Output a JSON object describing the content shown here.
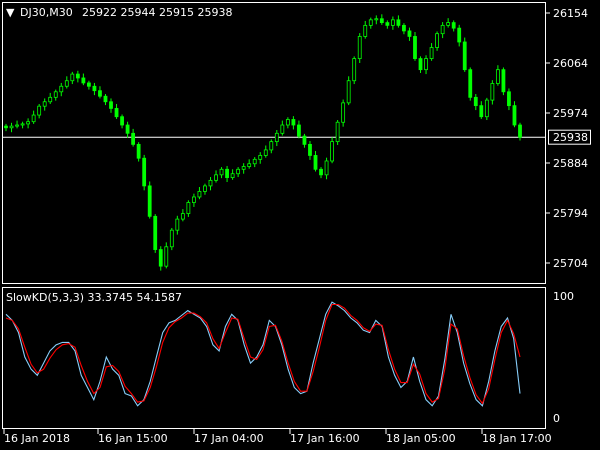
{
  "header": {
    "symbol": "DJ30,M30",
    "ohlc": "25922 25944 25915 25938"
  },
  "indicator": {
    "label": "SlowKD(5,3,3) 33.3745 54.1587"
  },
  "price_axis": {
    "ticks": [
      "26154",
      "26064",
      "25974",
      "25884",
      "25794",
      "25704"
    ],
    "current_price_label": "25938",
    "current_price": 25938,
    "range": [
      25680,
      26175
    ]
  },
  "indicator_axis": {
    "ticks": [
      "100",
      "0"
    ],
    "range": [
      0,
      100
    ]
  },
  "time_axis": {
    "ticks": [
      "16 Jan 2018",
      "16 Jan 15:00",
      "17 Jan 04:00",
      "17 Jan 16:00",
      "18 Jan 05:00",
      "18 Jan 17:00"
    ]
  },
  "colors": {
    "background": "#000000",
    "candle": "#00ff00",
    "grid_line": "#ffffff",
    "stoch_main": "#87cefa",
    "stoch_signal": "#ff0000"
  },
  "chart_data": {
    "type": "candlestick",
    "price_closes": [
      25955,
      25958,
      25960,
      25962,
      25966,
      25978,
      25994,
      26002,
      26010,
      26020,
      26030,
      26040,
      26052,
      26045,
      26036,
      26030,
      26022,
      26012,
      26002,
      25990,
      25975,
      25960,
      25945,
      25925,
      25900,
      25850,
      25795,
      25735,
      25705,
      25740,
      25770,
      25790,
      25800,
      25820,
      25830,
      25840,
      25850,
      25860,
      25870,
      25880,
      25865,
      25872,
      25880,
      25885,
      25890,
      25898,
      25905,
      25915,
      25930,
      25945,
      25960,
      25970,
      25960,
      25940,
      25925,
      25905,
      25880,
      25870,
      25895,
      25930,
      25965,
      26000,
      26040,
      26080,
      26120,
      26140,
      26150,
      26152,
      26145,
      26140,
      26150,
      26140,
      26130,
      26120,
      26080,
      26060,
      26080,
      26100,
      26125,
      26140,
      26145,
      26135,
      26110,
      26060,
      26010,
      25995,
      25975,
      26005,
      26035,
      26060,
      26020,
      25995,
      25960,
      25938
    ],
    "stoch_main": [
      85,
      80,
      70,
      50,
      40,
      35,
      45,
      55,
      60,
      62,
      62,
      55,
      35,
      25,
      15,
      30,
      50,
      40,
      35,
      20,
      18,
      10,
      15,
      30,
      50,
      70,
      78,
      80,
      84,
      88,
      85,
      82,
      75,
      60,
      55,
      75,
      85,
      80,
      60,
      45,
      50,
      60,
      80,
      75,
      60,
      40,
      25,
      20,
      22,
      45,
      65,
      85,
      95,
      92,
      88,
      82,
      78,
      72,
      70,
      80,
      75,
      50,
      35,
      25,
      30,
      50,
      30,
      15,
      10,
      18,
      48,
      85,
      70,
      45,
      28,
      15,
      10,
      30,
      55,
      75,
      82,
      65,
      20
    ],
    "stoch_signal": [
      82,
      80,
      73,
      58,
      44,
      37,
      40,
      49,
      56,
      60,
      61,
      58,
      43,
      30,
      20,
      25,
      42,
      43,
      38,
      26,
      20,
      13,
      14,
      25,
      42,
      62,
      74,
      79,
      82,
      86,
      86,
      83,
      78,
      65,
      57,
      70,
      82,
      81,
      65,
      50,
      48,
      56,
      75,
      76,
      63,
      45,
      30,
      22,
      22,
      38,
      58,
      80,
      93,
      93,
      90,
      84,
      80,
      74,
      71,
      77,
      76,
      56,
      40,
      29,
      29,
      44,
      36,
      20,
      13,
      16,
      40,
      77,
      73,
      51,
      33,
      19,
      12,
      24,
      48,
      70,
      80,
      69,
      50
    ]
  }
}
